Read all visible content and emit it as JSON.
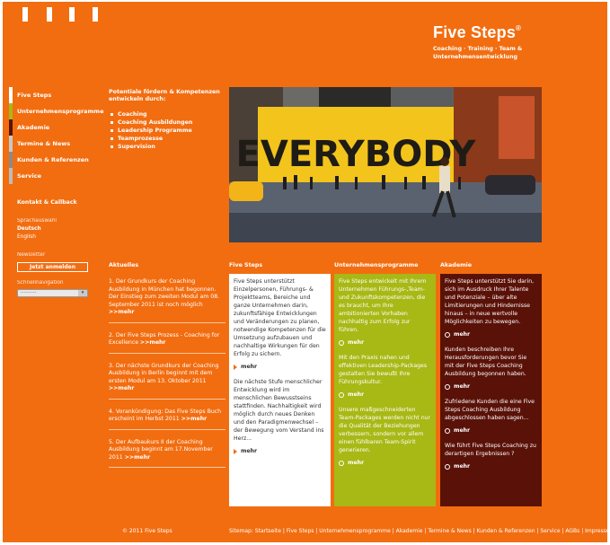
{
  "brand": {
    "name": "Five Steps",
    "reg": "®",
    "tagline": "Coaching · Training · Team & Unternehmensentwicklung"
  },
  "nav": [
    {
      "label": "Five Steps",
      "color": "#ffffff"
    },
    {
      "label": "Unternehmensprogramme",
      "color": "#a8b815"
    },
    {
      "label": "Akademie",
      "color": "#5a1208"
    },
    {
      "label": "Termine & News",
      "color": "#c8c8c8"
    },
    {
      "label": "Kunden & Referenzen",
      "color": "#8a8a8a"
    },
    {
      "label": "Service",
      "color": "#bcbcbc"
    }
  ],
  "side": {
    "kontakt": "Kontakt & Callback",
    "sprachauswahl": "Sprachauswahl",
    "deutsch": "Deutsch",
    "english": "English",
    "newsletter": "Newsletter",
    "newsletter_btn": "Jetzt anmelden",
    "schnell": "Schnellnavigation",
    "quick_value": "··········"
  },
  "intro": {
    "text": "Potentiale fördern & Kompetenzen entwickeln durch:",
    "items": [
      "Coaching",
      "Coaching Ausbildungen",
      "Leadership Programme",
      "Teamprozesse",
      "Supervision"
    ]
  },
  "hero": {
    "sign": "EVERYBODY"
  },
  "headings": {
    "aktuelles": "Aktuelles",
    "fivesteps": "Five Steps",
    "unternehmen": "Unternehmensprogramme",
    "akademie": "Akademie"
  },
  "news": [
    {
      "text": "1. Der Grundkurs der Coaching Ausbildung in München hat begonnen. Der Einstieg zum zweiten Modul am 08. September 2011 ist noch möglich ",
      "more": ">>mehr"
    },
    {
      "text": "2. Der Five Steps Prozess - Coaching for Excellence ",
      "more": ">>mehr"
    },
    {
      "text": "3. Der nächste Grundkurs der Coaching Ausbildung in Berlin beginnt mit dem ersten Modul am 13. Oktober 2011 ",
      "more": ">>mehr"
    },
    {
      "text": "4. Vorankündigung: Das Five Steps Buch erscheint im Herbst 2011 ",
      "more": ">>mehr"
    },
    {
      "text": "5. Der Aufbaukurs II der Coaching Ausbildung beginnt am 17.November 2011 ",
      "more": ">>mehr"
    }
  ],
  "fivesteps": {
    "p1": "Five Steps unterstützt Einzelpersonen, Führungs- & Projektteams, Bereiche und ganze Unternehmen darin, zukunftsfähige Entwicklungen und Veränderungen zu planen, notwendige Kompetenzen für die Umsetzung aufzubauen und nachhaltige Wirkungen für den Erfolg zu sichern.",
    "p2": "Die nächste Stufe menschlicher Entwicklung wird im menschlichen Bewusstseins stattfinden. Nachhaltigkeit wird möglich durch neues Denken und den Paradigmenwechsel – der Bewegung vom Verstand ins Herz...",
    "more": "mehr"
  },
  "unternehmen": {
    "p1": "Five Steps entwickelt mit Ihrem Unternehmen Führungs-,Team-und Zukunftskompetenzen, die es braucht, um Ihre ambitionierten Vorhaben nachhaltig zum Erfolg zur führen.",
    "p2": "Mit den Praxis nahen und effektiven Leadership-Packages gestalten Sie bewußt Ihre Führungskultur.",
    "p3": "Unsere maßgeschneiderten Team-Packages werden nicht nur die Qualität der Beziehungen verbessern, sondern vor allem einen fühlbaren Team-Spirit generieren.",
    "more": "mehr"
  },
  "akademie": {
    "p1": "Five Steps unterstützt Sie darin, sich im Ausdruck Ihrer Talente und Potenziale – über alte Limitierungen und Hindernisse hinaus – in neue wertvolle Möglichkeiten zu bewegen.",
    "p2": "Kunden beschreiben Ihre Herausforderungen bevor Sie mit der Five Steps Coaching Ausbildung begonnen haben.",
    "p3": "Zufriedene Kunden die eine Five Steps Coaching Ausbildung abgeschlossen haben sagen...",
    "p4": "Wie führt Five Steps Coaching zu derartigen Ergebnissen ?",
    "more": "mehr"
  },
  "footer": {
    "copy": "© 2011 Five Steps",
    "sitemap": [
      "Sitemap: Startseite",
      "Five Steps",
      "Unternehmensprogramme",
      "Akademie",
      "Termine & News",
      "Kunden & Referenzen",
      "Service",
      "AGBs",
      "Impressum"
    ]
  }
}
